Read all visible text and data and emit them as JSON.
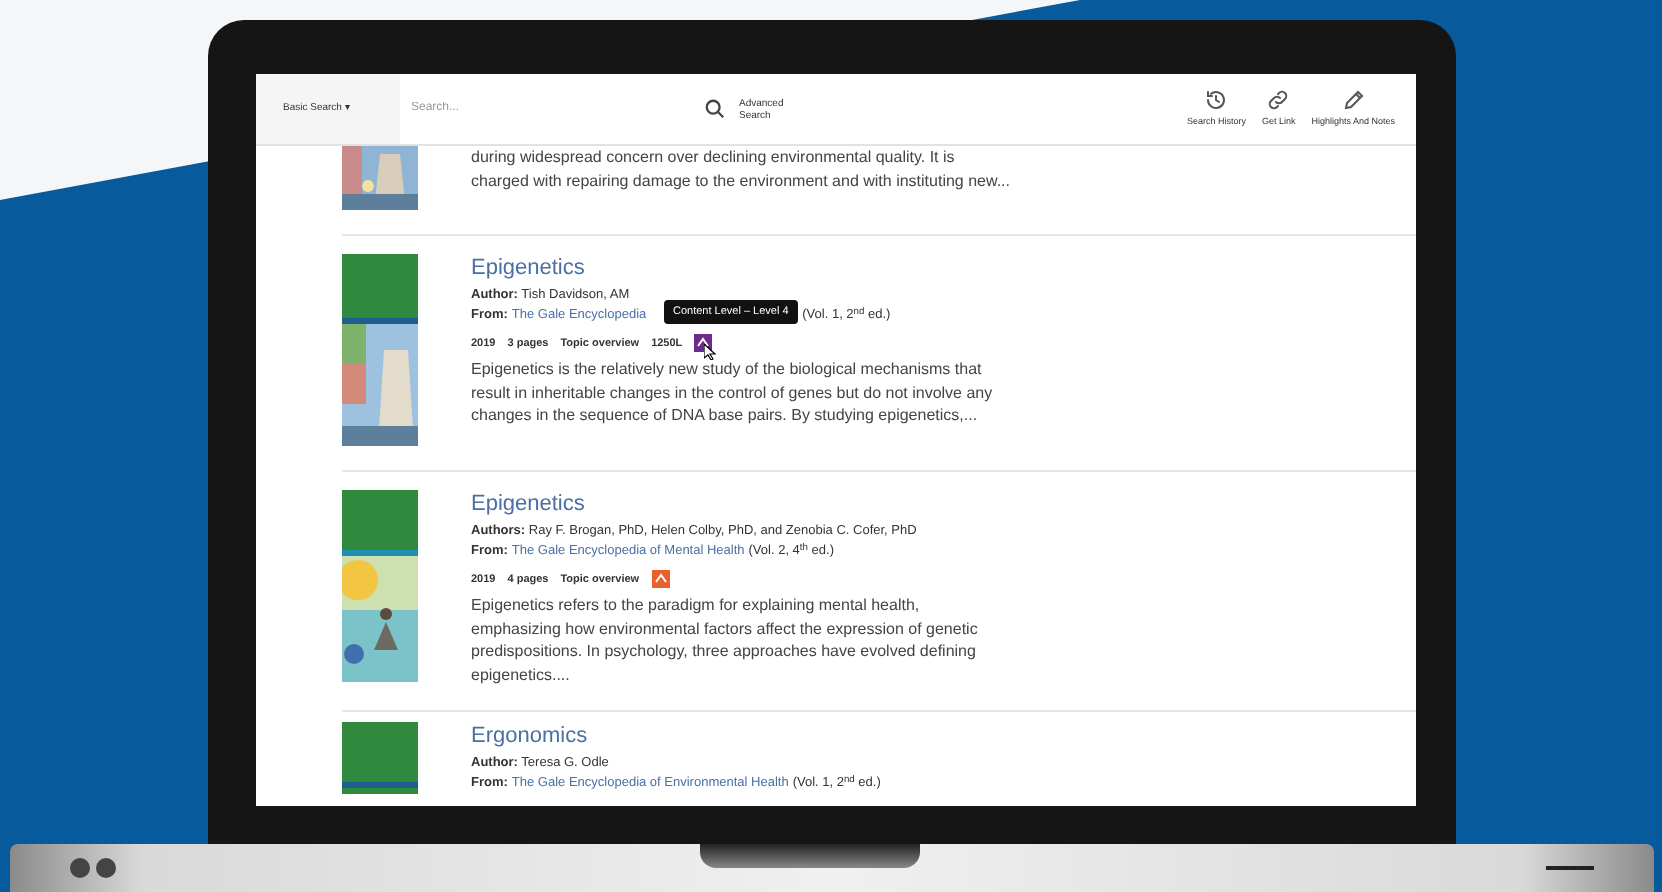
{
  "toolbar": {
    "search_type": "Basic Search ▾",
    "placeholder": "Search...",
    "advanced": "Advanced Search",
    "actions": [
      {
        "kind": "history",
        "label": "Search History"
      },
      {
        "kind": "link",
        "label": "Get Link"
      },
      {
        "kind": "pen",
        "label": "Highlights And Notes"
      }
    ]
  },
  "results": [
    {
      "snippet": "during widespread concern over declining environmental quality. It is charged with repairing damage to the environment and with instituting new..."
    },
    {
      "title": "Epigenetics",
      "author_label": "Author:",
      "author": "Tish Davidson, AM",
      "from_label": "From:",
      "source": "The Gale Encyclopedia",
      "edition": "(Vol. 1, 2$^{nd}$ ed.)",
      "tags": [
        "2019",
        "3 pages",
        "Topic overview",
        "1250L"
      ],
      "level_icon": {
        "color": "#6b2a8c",
        "hovered": true
      },
      "tooltip": "Content Level – Level 4",
      "snippet": "Epigenetics is the relatively new study of the biological mechanisms that result in inheritable changes in the control of genes but do not involve any changes in the sequence of DNA base pairs. By studying epigenetics,..."
    },
    {
      "title": "Epigenetics",
      "author_label": "Authors:",
      "author": "Ray F. Brogan, PhD, Helen Colby, PhD, and Zenobia C. Cofer, PhD",
      "from_label": "From:",
      "source": "The Gale Encyclopedia of Mental Health",
      "edition": "(Vol. 2, 4$^{th}$ ed.)",
      "tags": [
        "2019",
        "4 pages",
        "Topic overview"
      ],
      "level_icon": {
        "color": "#e8602c",
        "hovered": false
      },
      "snippet": "Epigenetics refers to the paradigm for explaining mental health, emphasizing how environmental factors affect the expression of genetic predispositions. In psychology, three approaches have evolved defining epigenetics...."
    },
    {
      "title": "Ergonomics",
      "author_label": "Author:",
      "author": "Teresa G. Odle",
      "from_label": "From:",
      "source": "The Gale Encyclopedia of Environmental Health",
      "edition": "(Vol. 1, 2$^{nd}$ ed.)"
    }
  ]
}
